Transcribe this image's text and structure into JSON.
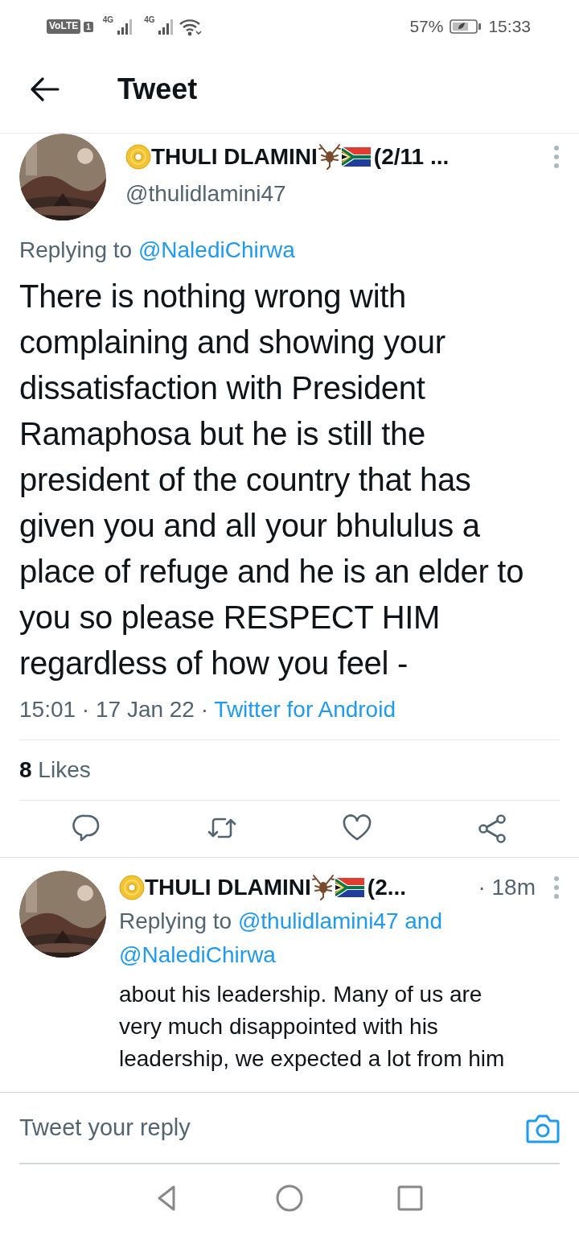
{
  "status_bar": {
    "volte": "VoLTE",
    "sim": "1",
    "network_1": "4G",
    "network_2": "4G",
    "battery_percent": "57%",
    "time": "15:33"
  },
  "header": {
    "title": "Tweet"
  },
  "tweet": {
    "name": "THULI DLAMINI",
    "name_tail": "(2/11 ...",
    "handle": "@thulidlamini47",
    "replying_to": {
      "prefix": "Replying to",
      "mentions": [
        "@NalediChirwa"
      ]
    },
    "text": "There is nothing wrong with complaining and showing your dissatisfaction with President Ramaphosa but he is still the president of the country that has given you and all your bhululus a place of refuge and he is an elder to you so please RESPECT HIM regardless of how you feel -",
    "timestamp": "15:01 · 17 Jan 22 ·",
    "source": "Twitter for Android",
    "likes": {
      "count": "8",
      "label": "Likes"
    },
    "actions": [
      {
        "kind": "reply"
      },
      {
        "kind": "retweet"
      },
      {
        "kind": "like"
      },
      {
        "kind": "share"
      }
    ]
  },
  "reply": {
    "name": "THULI DLAMINI",
    "name_tail": "(2...",
    "time": "· 18m",
    "replying_to": {
      "prefix": "Replying to",
      "mentions": [
        "@thulidlamini47",
        "@NalediChirwa"
      ],
      "joiner": "and"
    },
    "text": "about his leadership. Many of us are very much disappointed with his leadership, we expected a lot from him"
  },
  "compose": {
    "placeholder": "Tweet your reply"
  },
  "nav_bar": [
    {
      "kind": "back"
    },
    {
      "kind": "home"
    },
    {
      "kind": "recents"
    }
  ]
}
